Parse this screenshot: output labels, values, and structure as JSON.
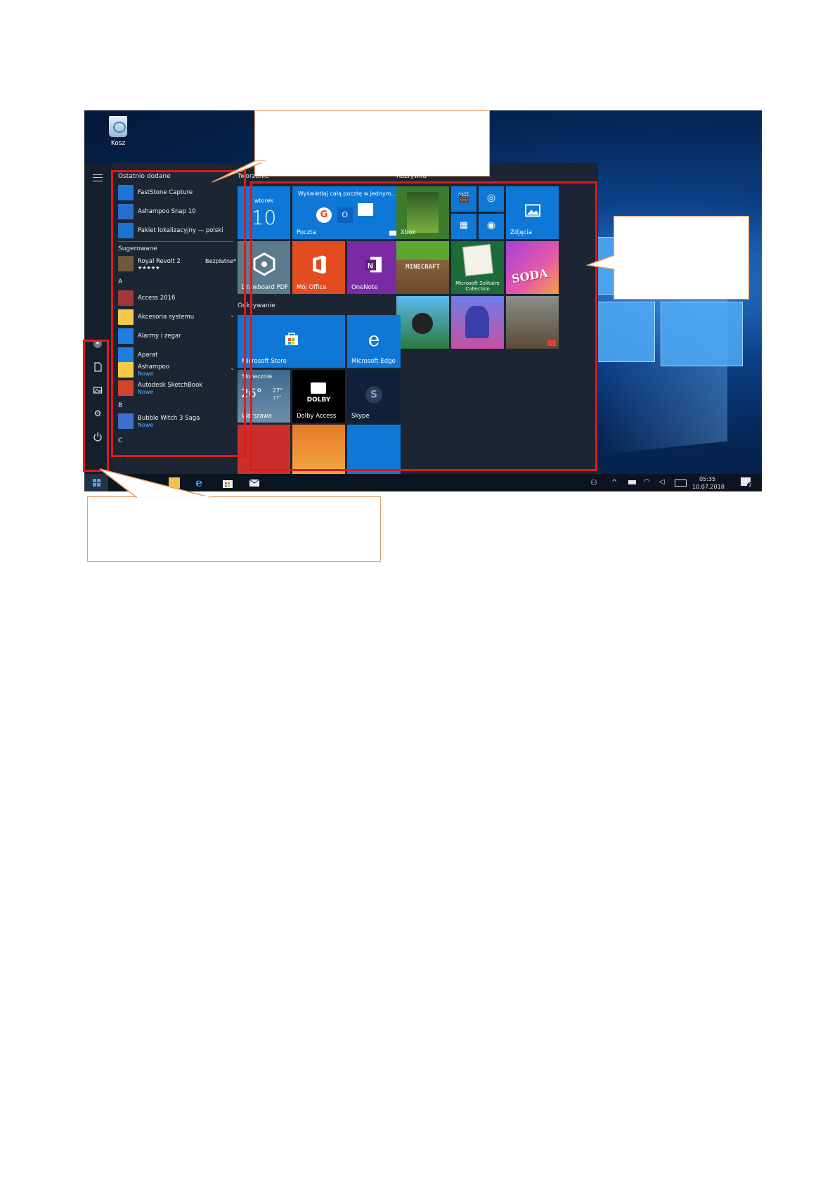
{
  "desktop": {
    "recycle_bin_label": "Kosz"
  },
  "start_menu": {
    "recently_added_header": "Ostatnio dodane",
    "recent_items": [
      {
        "label": "FastStone Capture",
        "color": "#1e74d8"
      },
      {
        "label": "Ashampoo Snap 10",
        "color": "#2a6bd2"
      },
      {
        "label": "Pakiet lokalizacyjny — polski",
        "color": "#1874cf"
      }
    ],
    "suggested_header": "Sugerowane",
    "suggested": {
      "label": "Royal Revolt 2",
      "rating": "★★★★★",
      "price": "Bezpłatne*"
    },
    "letter_a": "A",
    "a_items": [
      {
        "label": "Access 2016",
        "sub": "",
        "chevron": false,
        "color": "#a4373a"
      },
      {
        "label": "Akcesoria systemu",
        "sub": "",
        "chevron": true,
        "color": "#f7c948"
      },
      {
        "label": "Alarmy i zegar",
        "sub": "",
        "chevron": false,
        "color": "#1e7fe0"
      },
      {
        "label": "Aparat",
        "sub": "",
        "chevron": false,
        "color": "#1e7fe0"
      },
      {
        "label": "Ashampoo",
        "sub": "Nowe",
        "chevron": true,
        "color": "#f7c948"
      },
      {
        "label": "Autodesk SketchBook",
        "sub": "Nowe",
        "chevron": false,
        "color": "#d0452c"
      }
    ],
    "letter_b": "B",
    "b_items": [
      {
        "label": "Bubble Witch 3 Saga",
        "sub": "Nowe",
        "color": "#3d6fd0"
      }
    ],
    "letter_c": "C"
  },
  "tiles": {
    "group_create": "Tworzenie",
    "group_play": "Rozrywka",
    "group_explore": "Odkrywanie",
    "calendar": {
      "day": "wtorek",
      "date": "10"
    },
    "mail": {
      "headline": "Wyświetlaj całą pocztę w jednym...",
      "label": "Poczta"
    },
    "drawboard": "Drawboard PDF",
    "office": "Mój Office",
    "onenote": "OneNote",
    "xbox": "Xbox",
    "photos": "Zdjęcia",
    "minecraft": "MINECRAFT",
    "solitaire": "Microsoft Solitaire Collection",
    "candy": "SODA",
    "store": "Microsoft Store",
    "edge": "Microsoft Edge",
    "weather": {
      "condition": "Słonecznie",
      "temp": "26°",
      "high": "27°",
      "low": "17°",
      "city": "Warszawa"
    },
    "dolby": {
      "logo": "DOLBY",
      "label": "Dolby Access"
    },
    "skype": "Skype"
  },
  "taskbar": {
    "time": "05:35",
    "date": "10.07.2018",
    "notifications": "2"
  },
  "colors": {
    "highlight": "#e21919",
    "callout_border": "#e8a067",
    "tile_blue": "#0f78d7"
  }
}
